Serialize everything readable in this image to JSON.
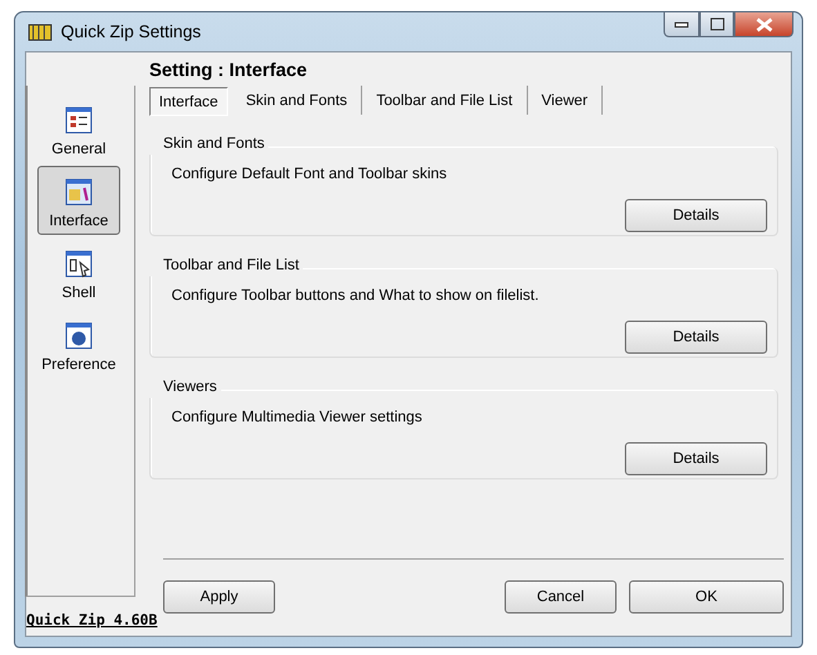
{
  "window": {
    "title": "Quick Zip Settings"
  },
  "header": "Setting : Interface",
  "sidebar": {
    "items": [
      {
        "label": "General",
        "selected": false
      },
      {
        "label": "Interface",
        "selected": true
      },
      {
        "label": "Shell",
        "selected": false
      },
      {
        "label": "Preference",
        "selected": false
      }
    ]
  },
  "tabs": [
    {
      "label": "Interface",
      "selected": true
    },
    {
      "label": "Skin and Fonts",
      "selected": false
    },
    {
      "label": "Toolbar and File List",
      "selected": false
    },
    {
      "label": "Viewer",
      "selected": false
    }
  ],
  "groups": [
    {
      "title": "Skin and Fonts",
      "description": "Configure Default Font and Toolbar skins",
      "button": "Details"
    },
    {
      "title": "Toolbar and File List",
      "description": "Configure Toolbar buttons and  What to show on filelist.",
      "button": "Details"
    },
    {
      "title": "Viewers",
      "description": "Configure Multimedia Viewer settings",
      "button": "Details"
    }
  ],
  "version_link": "Quick Zip 4.60B",
  "buttons": [
    {
      "label": "Apply"
    },
    {
      "label": "Cancel"
    },
    {
      "label": "OK"
    }
  ]
}
